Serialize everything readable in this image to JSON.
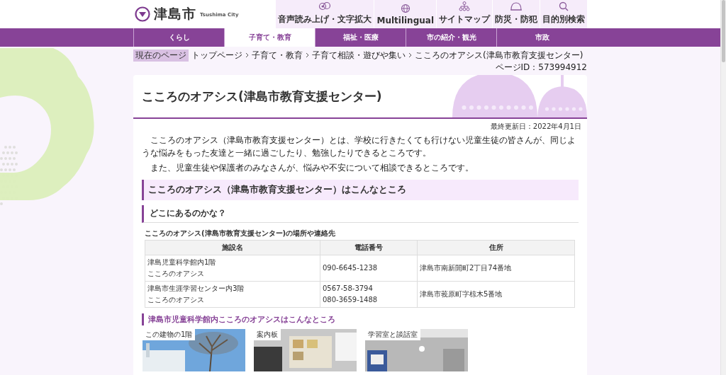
{
  "site": {
    "name": "津島市",
    "subtitle": "Tsushima City"
  },
  "utility_links": [
    {
      "label": "音声読み上げ・文字拡大"
    },
    {
      "label": "Multilingual"
    },
    {
      "label": "サイトマップ"
    },
    {
      "label": "防災・防犯"
    },
    {
      "label": "目的別検索"
    }
  ],
  "nav": [
    {
      "label": "くらし",
      "selected": false
    },
    {
      "label": "子育て・教育",
      "selected": true
    },
    {
      "label": "福祉・医療",
      "selected": false
    },
    {
      "label": "市の紹介・観光",
      "selected": false
    },
    {
      "label": "市政",
      "selected": false
    }
  ],
  "breadcrumb": {
    "badge": "現在のページ",
    "items": [
      "トップページ",
      "子育て・教育",
      "子育て相談・遊びや集い",
      "こころのオアシス(津島市教育支援センター)"
    ]
  },
  "page_id": "ページID：573994912",
  "title": "こころのオアシス(津島市教育支援センター)",
  "last_updated": "最終更新日：2022年4月1日",
  "paragraphs": [
    "こころのオアシス（津島市教育支援センター）とは、学校に行きたくても行けない児童生徒の皆さんが、同じような悩みをもった友達と一緒に過ごしたり、勉強したりできるところです。",
    "また、児童生徒や保護者のみなさんが、悩みや不安について相談できるところです。"
  ],
  "heading_2": "こころのオアシス（津島市教育支援センター）はこんなところ",
  "heading_3": "どこにあるのかな？",
  "table": {
    "caption": "こころのオアシス(津島市教育支援センター)の場所や連絡先",
    "columns": [
      "施設名",
      "電話番号",
      "住所"
    ],
    "rows": [
      [
        [
          "津島児童科学館内1階",
          "こころのオアシス"
        ],
        [
          "090-6645-1238"
        ],
        [
          "津島市南新開町2丁目74番地"
        ]
      ],
      [
        [
          "津島市生涯学習センター内3階",
          "こころのオアシス"
        ],
        [
          "0567-58-3794",
          "080-3659-1488"
        ],
        [
          "津島市莪原町字椋木5番地"
        ]
      ]
    ]
  },
  "heading_4": "津島市児童科学館内こころのオアシスはこんなところ",
  "photos": [
    {
      "caption": "この建物の1階",
      "kind": "picture"
    },
    {
      "caption": "案内板",
      "kind": "picture"
    },
    {
      "caption": "学習室と談話室",
      "kind": "picture"
    }
  ]
}
